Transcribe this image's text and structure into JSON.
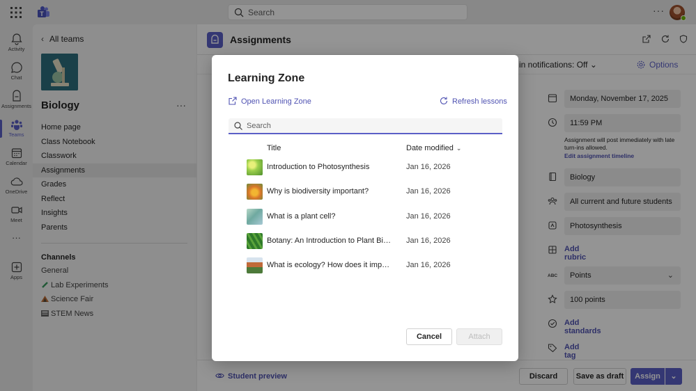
{
  "topbar": {
    "search_placeholder": "Search",
    "more": "···"
  },
  "rail": [
    {
      "label": "Activity",
      "icon": "bell-icon"
    },
    {
      "label": "Chat",
      "icon": "chat-icon"
    },
    {
      "label": "Assignments",
      "icon": "assignments-icon"
    },
    {
      "label": "Teams",
      "icon": "teams-icon"
    },
    {
      "label": "Calendar",
      "icon": "calendar-icon"
    },
    {
      "label": "OneDrive",
      "icon": "cloud-icon"
    },
    {
      "label": "Meet",
      "icon": "video-icon"
    },
    {
      "label": "···",
      "icon": "more-icon"
    },
    {
      "label": "Apps",
      "icon": "apps-icon"
    }
  ],
  "leftpanel": {
    "back_label": "All teams",
    "class_name": "Biology",
    "nav": [
      "Home page",
      "Class Notebook",
      "Classwork",
      "Assignments",
      "Grades",
      "Reflect",
      "Insights",
      "Parents"
    ],
    "channels_heading": "Channels",
    "channels": [
      "General",
      "Lab Experiments",
      "Science Fair",
      "STEM News"
    ]
  },
  "main": {
    "title": "Assignments",
    "notifications": "n in notifications: Off",
    "options": "Options",
    "date_due": "Monday, November 17, 2025",
    "time_due": "11:59 PM",
    "note": "Assignment will post immediately with late turn-ins allowed.",
    "note_link": "Edit assignment timeline",
    "class_field": "Biology",
    "students_field": "All current and future students",
    "category_field": "Photosynthesis",
    "add_rubric": "Add rubric",
    "points_type": "Points",
    "points_value": "100 points",
    "add_standards": "Add standards",
    "add_tag": "Add tag",
    "student_preview": "Student preview",
    "discard": "Discard",
    "save_draft": "Save as draft",
    "assign": "Assign"
  },
  "dialog": {
    "title": "Learning Zone",
    "open_link": "Open Learning Zone",
    "refresh_link": "Refresh lessons",
    "search_placeholder": "Search",
    "col_title": "Title",
    "col_date": "Date modified",
    "rows": [
      {
        "title": "Introduction to Photosynthesis",
        "date": "Jan 16, 2026"
      },
      {
        "title": "Why is biodiversity important?",
        "date": "Jan 16, 2026"
      },
      {
        "title": "What is a plant cell?",
        "date": "Jan 16, 2026"
      },
      {
        "title": "Botany: An Introduction to Plant Biol...",
        "date": "Jan 16, 2026"
      },
      {
        "title": "What is ecology? How does it impact...",
        "date": "Jan 16, 2026"
      }
    ],
    "cancel": "Cancel",
    "attach": "Attach"
  },
  "colors": {
    "accent": "#5b5fc7",
    "link": "#4f52b2",
    "presence": "#6bb700"
  }
}
